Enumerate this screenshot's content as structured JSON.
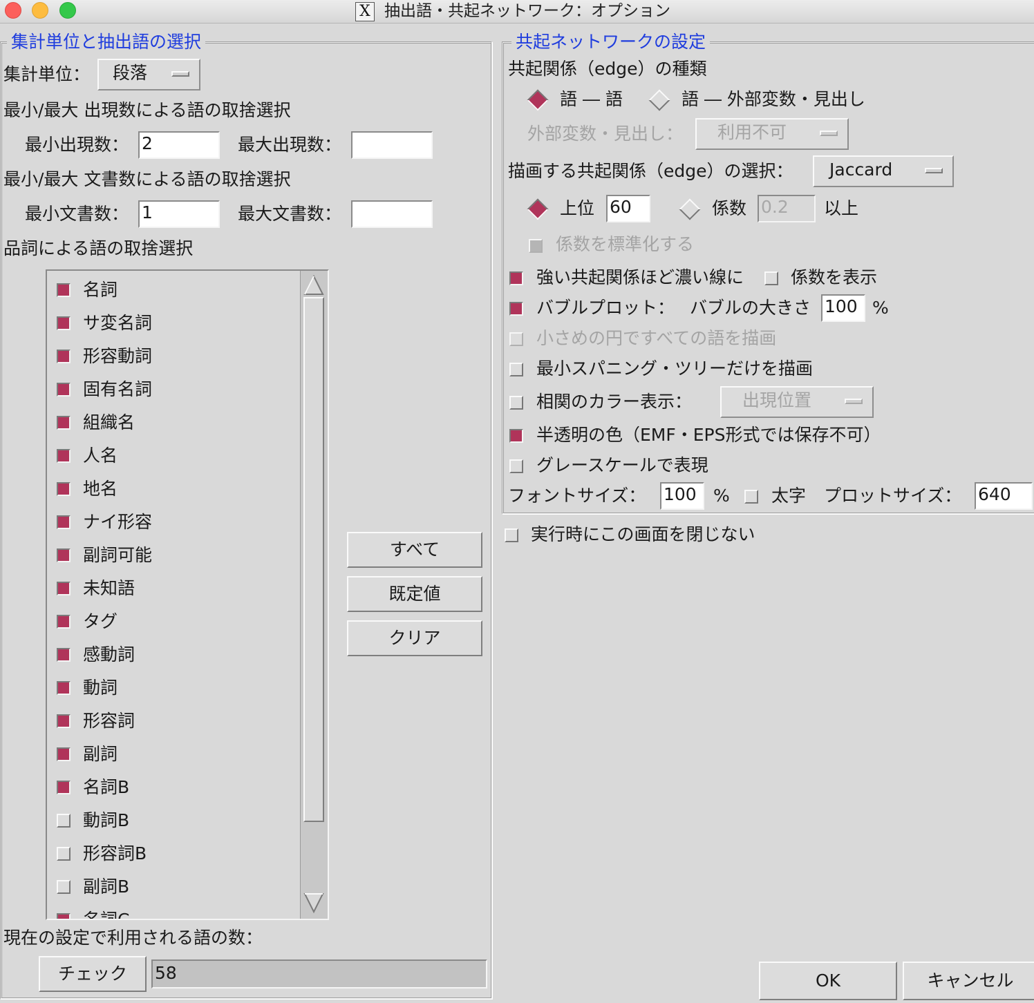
{
  "window": {
    "title": "抽出語・共起ネットワーク：オプション",
    "x_logo": "X"
  },
  "left": {
    "legend": "集計単位と抽出語の選択",
    "unit_label": "集計単位：",
    "unit_value": "段落",
    "freq_heading": "最小/最大 出現数による語の取捨選択",
    "min_freq_label": "最小出現数：",
    "min_freq_value": "2",
    "max_freq_label": "最大出現数：",
    "max_freq_value": "",
    "doc_heading": "最小/最大 文書数による語の取捨選択",
    "min_doc_label": "最小文書数：",
    "min_doc_value": "1",
    "max_doc_label": "最大文書数：",
    "max_doc_value": "",
    "pos_heading": "品詞による語の取捨選択",
    "pos_items": [
      {
        "label": "名詞",
        "checked": true
      },
      {
        "label": "サ変名詞",
        "checked": true
      },
      {
        "label": "形容動詞",
        "checked": true
      },
      {
        "label": "固有名詞",
        "checked": true
      },
      {
        "label": "組織名",
        "checked": true
      },
      {
        "label": "人名",
        "checked": true
      },
      {
        "label": "地名",
        "checked": true
      },
      {
        "label": "ナイ形容",
        "checked": true
      },
      {
        "label": "副詞可能",
        "checked": true
      },
      {
        "label": "未知語",
        "checked": true
      },
      {
        "label": "タグ",
        "checked": true
      },
      {
        "label": "感動詞",
        "checked": true
      },
      {
        "label": "動詞",
        "checked": true
      },
      {
        "label": "形容詞",
        "checked": true
      },
      {
        "label": "副詞",
        "checked": true
      },
      {
        "label": "名詞B",
        "checked": true
      },
      {
        "label": "動詞B",
        "checked": false
      },
      {
        "label": "形容詞B",
        "checked": false
      },
      {
        "label": "副詞B",
        "checked": false
      },
      {
        "label": "名詞C",
        "checked": true
      }
    ],
    "btn_all": "すべて",
    "btn_default": "既定値",
    "btn_clear": "クリア",
    "count_label": "現在の設定で利用される語の数：",
    "btn_check": "チェック",
    "count_value": "58"
  },
  "right": {
    "legend": "共起ネットワークの設定",
    "edge_type_label": "共起関係（edge）の種類",
    "radio_word_word": "語 ― 語",
    "radio_word_var": "語 ― 外部変数・見出し",
    "var_label": "外部変数・見出し：",
    "var_value": "利用不可",
    "edge_select_label": "描画する共起関係（edge）の選択：",
    "edge_select_value": "Jaccard",
    "top_label": "上位",
    "top_value": "60",
    "coef_label": "係数",
    "coef_value": "0.2",
    "coef_suffix": "以上",
    "standardize_label": "係数を標準化する",
    "strong_dark_label": "強い共起関係ほど濃い線に",
    "show_coef_label": "係数を表示",
    "bubble_label": "バブルプロット：",
    "bubble_size_label": "バブルの大きさ",
    "bubble_size_value": "100",
    "bubble_size_unit": "%",
    "small_circle_label": "小さめの円ですべての語を描画",
    "mst_label": "最小スパニング・ツリーだけを描画",
    "color_label": "相関のカラー表示：",
    "color_value": "出現位置",
    "translucent_label": "半透明の色（EMF・EPS形式では保存不可）",
    "grayscale_label": "グレースケールで表現",
    "font_size_label": "フォントサイズ：",
    "font_size_value": "100",
    "font_size_unit": "%",
    "bold_label": "太字",
    "plot_size_label": "プロットサイズ：",
    "plot_size_value": "640"
  },
  "footer": {
    "keep_open_label": "実行時にこの画面を閉じない",
    "ok": "OK",
    "cancel": "キャンセル"
  }
}
